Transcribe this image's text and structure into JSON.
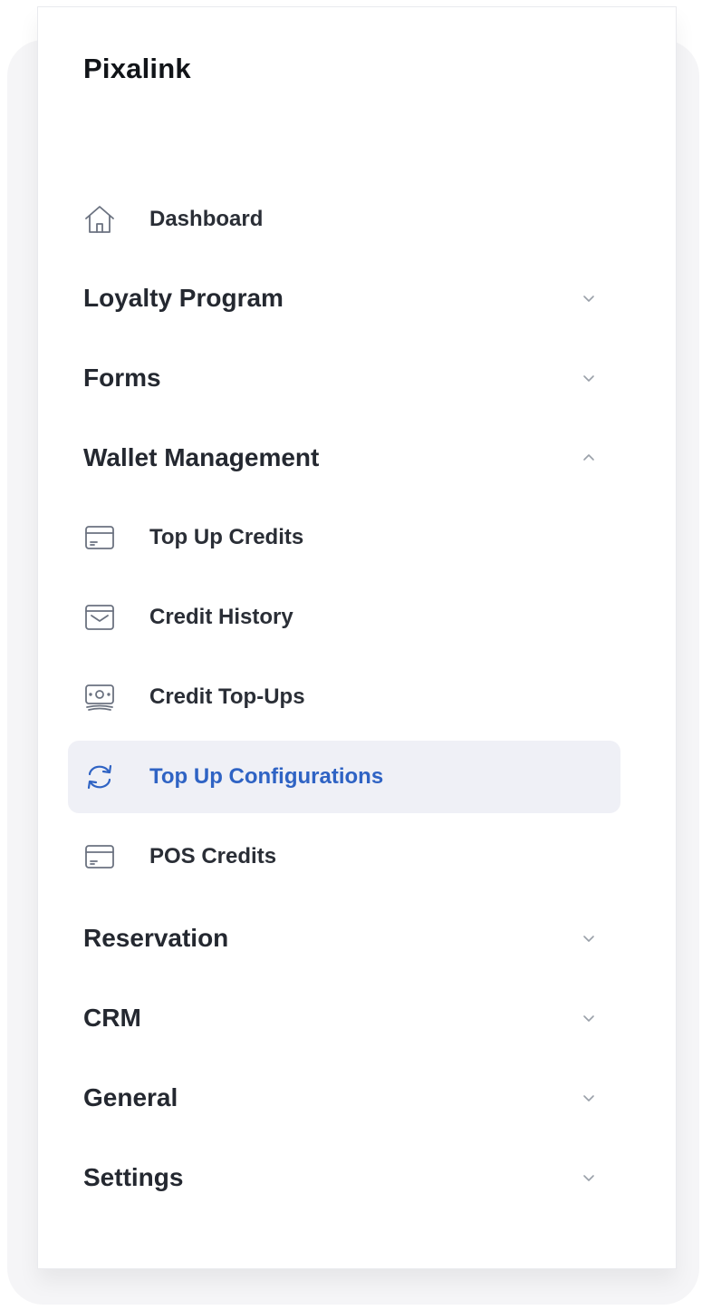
{
  "brand": {
    "name": "Pixalink"
  },
  "nav": {
    "dashboard": {
      "label": "Dashboard",
      "icon": "home-icon"
    },
    "loyalty": {
      "label": "Loyalty Program",
      "expanded": false
    },
    "forms": {
      "label": "Forms",
      "expanded": false
    },
    "wallet": {
      "label": "Wallet Management",
      "expanded": true,
      "items": [
        {
          "label": "Top Up Credits",
          "icon": "card-icon"
        },
        {
          "label": "Credit History",
          "icon": "inbox-icon"
        },
        {
          "label": "Credit Top-Ups",
          "icon": "cash-icon"
        },
        {
          "label": "Top Up Configurations",
          "icon": "refresh-icon",
          "active": true
        },
        {
          "label": "POS Credits",
          "icon": "card-icon"
        }
      ]
    },
    "reservation": {
      "label": "Reservation",
      "expanded": false
    },
    "crm": {
      "label": "CRM",
      "expanded": false
    },
    "general": {
      "label": "General",
      "expanded": false
    },
    "settings": {
      "label": "Settings",
      "expanded": false
    }
  },
  "colors": {
    "active_text": "#2f63c4",
    "active_bg": "#eff0f6",
    "text": "#242830",
    "icon": "#6b7280"
  }
}
